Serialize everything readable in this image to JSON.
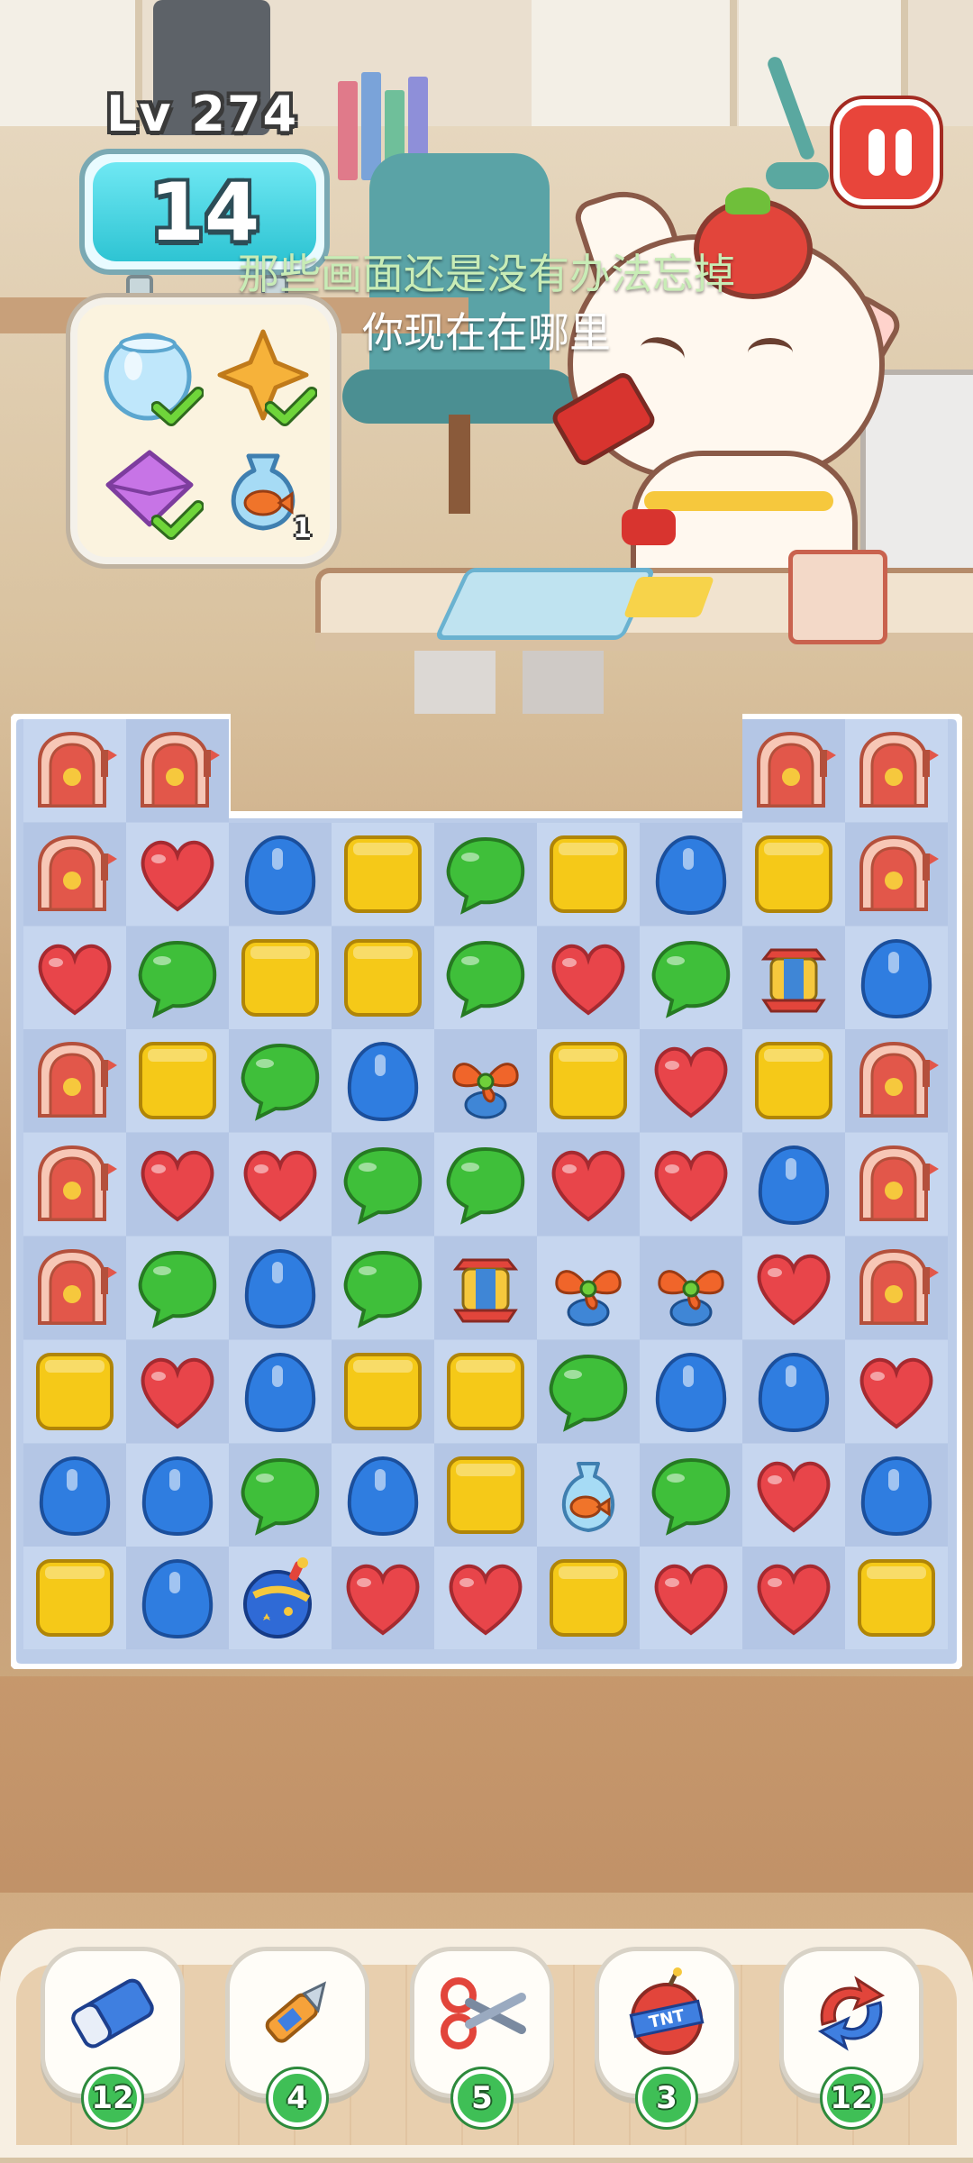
{
  "hud": {
    "level": "Lv 274",
    "moves": "14",
    "pause_icon": "pause-icon"
  },
  "goals": [
    {
      "name": "fishbowl",
      "icon": "fishbowl-icon",
      "done": true
    },
    {
      "name": "star-cookie",
      "icon": "star-cookie-icon",
      "done": true
    },
    {
      "name": "envelope",
      "icon": "envelope-icon",
      "done": true
    },
    {
      "name": "goldfish-bag",
      "icon": "goldfish-bag-icon",
      "done": false,
      "remaining": "1"
    }
  ],
  "subtitles": {
    "line1": "那些画面还是没有办法忘掉",
    "line2": "你现在在哪里"
  },
  "board": {
    "cols": 9,
    "rows": 9,
    "grid": [
      [
        "mailbox",
        "mailbox",
        "none",
        "none",
        "none",
        "none",
        "none",
        "mailbox",
        "mailbox"
      ],
      [
        "mailbox",
        "heart",
        "blue",
        "yellow",
        "green",
        "yellow",
        "blue",
        "yellow",
        "mailbox"
      ],
      [
        "heart",
        "green",
        "yellow",
        "yellow",
        "green",
        "heart",
        "green",
        "lantern",
        "blue"
      ],
      [
        "mailbox",
        "yellow",
        "green",
        "blue",
        "fan",
        "yellow",
        "heart",
        "yellow",
        "mailbox"
      ],
      [
        "mailbox",
        "heart",
        "heart",
        "green",
        "green",
        "heart",
        "heart",
        "blue",
        "mailbox"
      ],
      [
        "mailbox",
        "green",
        "blue",
        "green",
        "lantern",
        "fan",
        "fan",
        "heart",
        "mailbox"
      ],
      [
        "yellow",
        "heart",
        "blue",
        "yellow",
        "yellow",
        "green",
        "blue",
        "blue",
        "heart"
      ],
      [
        "blue",
        "blue",
        "green",
        "blue",
        "yellow",
        "goldfish",
        "green",
        "heart",
        "blue"
      ],
      [
        "yellow",
        "blue",
        "bomb",
        "heart",
        "heart",
        "yellow",
        "heart",
        "heart",
        "yellow"
      ]
    ]
  },
  "boosters": [
    {
      "name": "eraser",
      "icon": "eraser-icon",
      "count": "12"
    },
    {
      "name": "cutter",
      "icon": "box-cutter-icon",
      "count": "4"
    },
    {
      "name": "scissors",
      "icon": "scissors-icon",
      "count": "5"
    },
    {
      "name": "tnt",
      "icon": "tnt-icon",
      "count": "3"
    },
    {
      "name": "shuffle",
      "icon": "shuffle-icon",
      "count": "12"
    }
  ],
  "colors": {
    "heart": "#e8454a",
    "blue": "#2f7de0",
    "green": "#3fbf3a",
    "yellow": "#f5c918",
    "moves_box": "#2ec4d3",
    "pause": "#e8453b",
    "badge": "#3fbf56"
  }
}
